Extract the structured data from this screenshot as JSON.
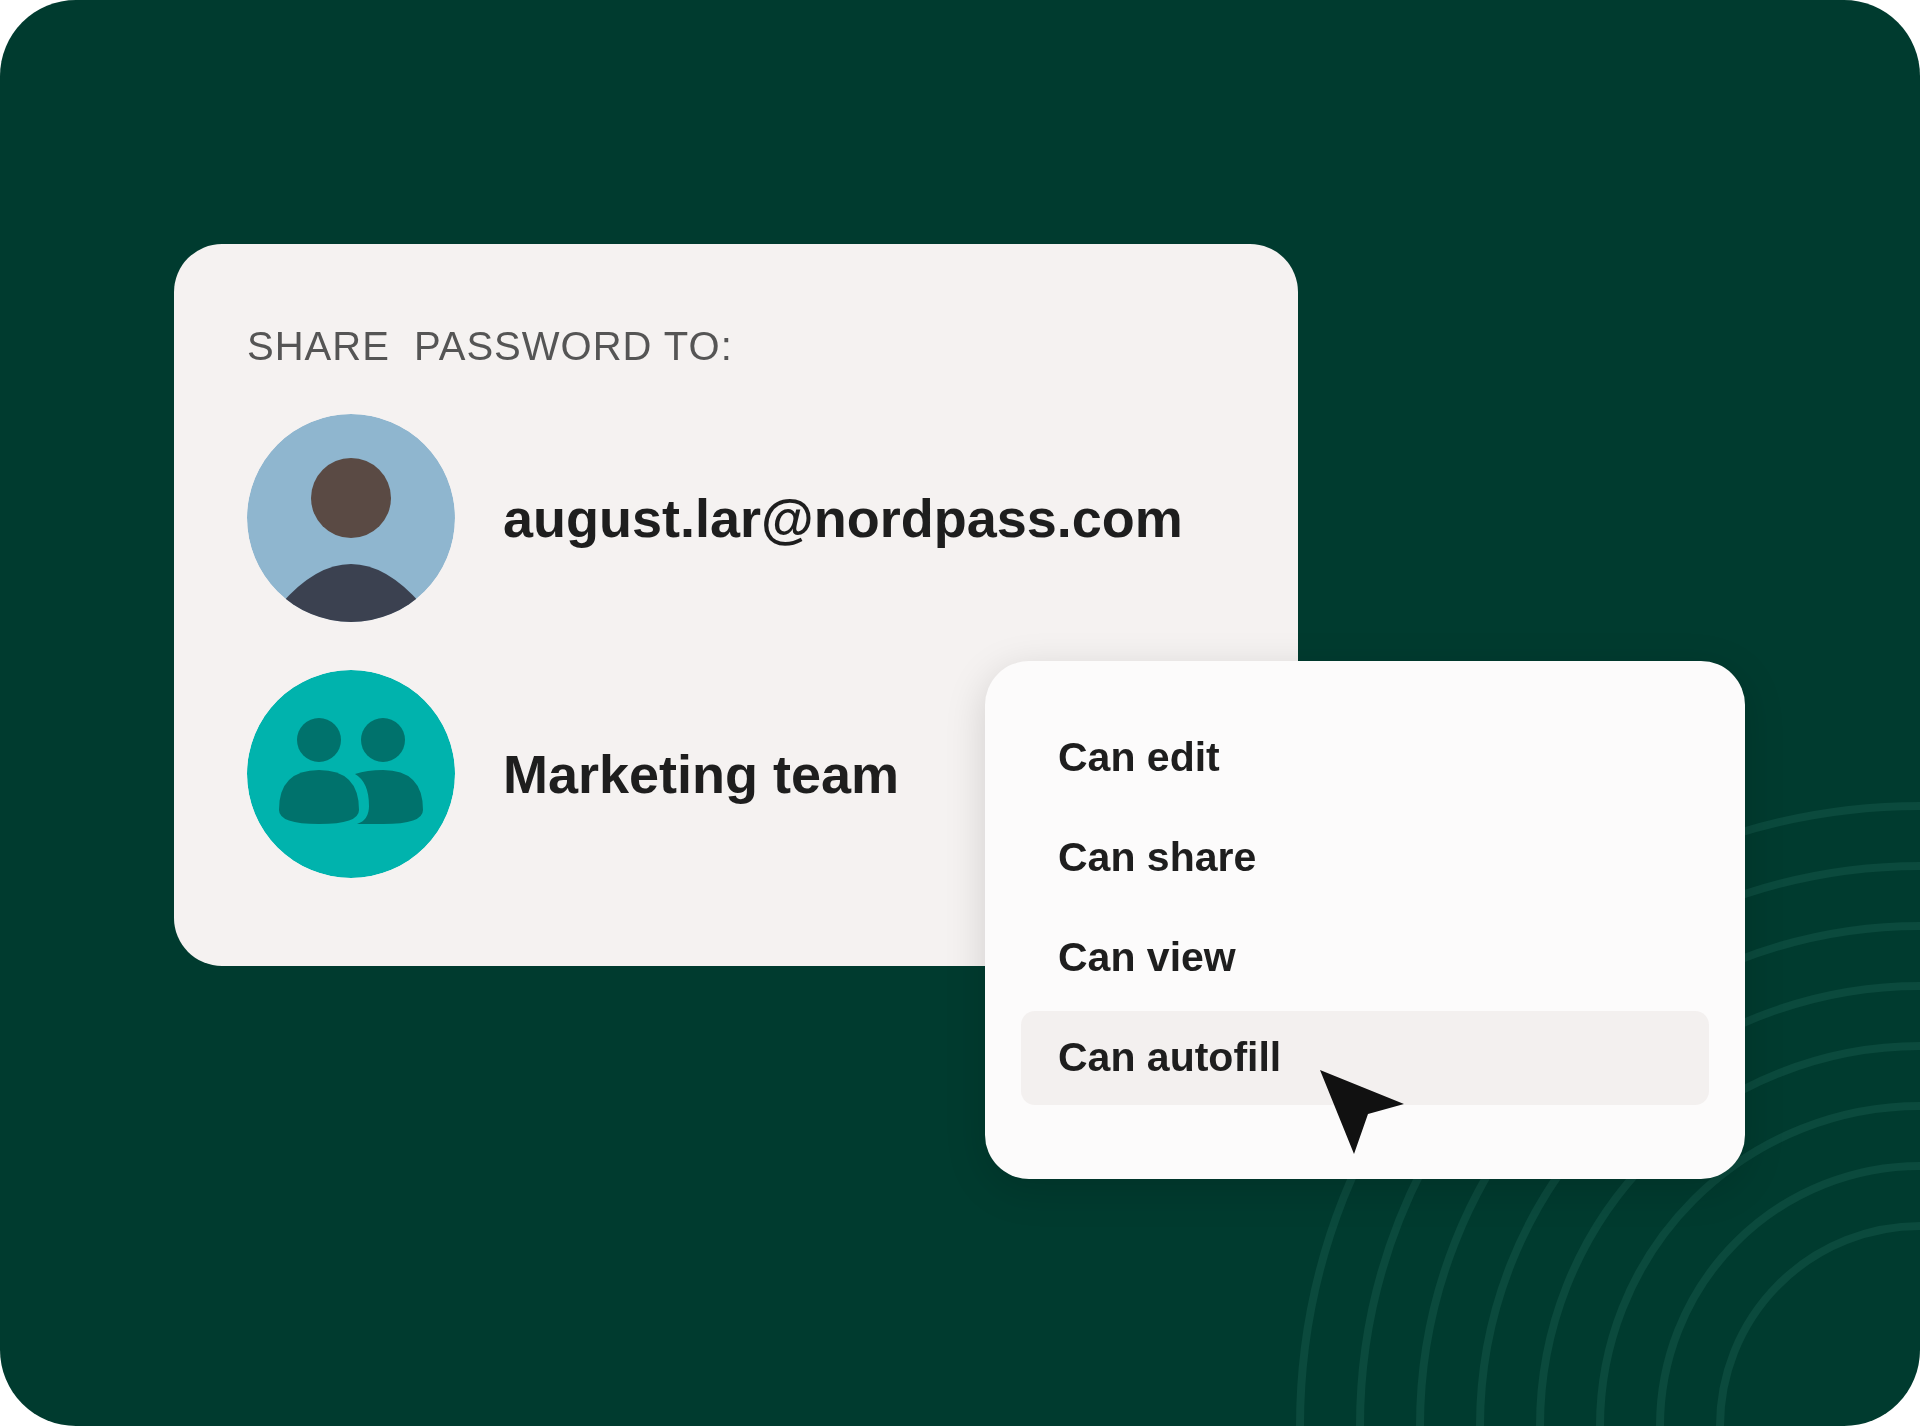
{
  "share_card": {
    "title": "SHARE  PASSWORD TO:",
    "recipients": [
      {
        "kind": "person",
        "label": "august.lar@nordpass.com"
      },
      {
        "kind": "group",
        "label": "Marketing team"
      }
    ]
  },
  "permission_menu": {
    "items": [
      {
        "label": "Can edit",
        "selected": false
      },
      {
        "label": "Can share",
        "selected": false
      },
      {
        "label": "Can view",
        "selected": false
      },
      {
        "label": "Can autofill",
        "selected": true
      }
    ]
  }
}
